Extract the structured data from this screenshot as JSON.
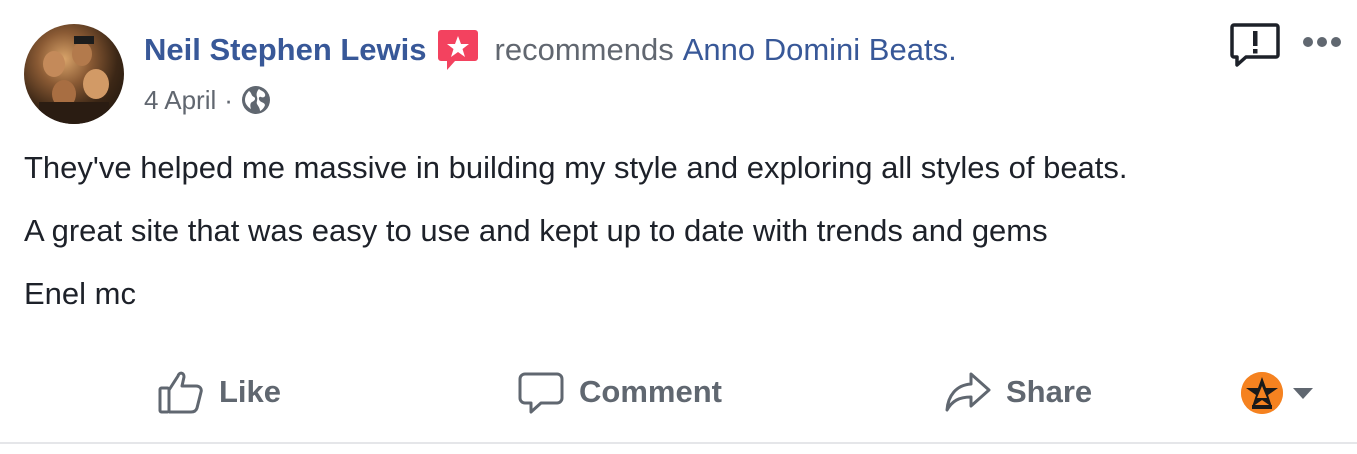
{
  "post": {
    "author": "Neil Stephen Lewis",
    "action_text": "recommends",
    "page_name": "Anno Domini Beats",
    "page_name_suffix": ".",
    "date": "4 April",
    "meta_separator": "·",
    "privacy_icon": "globe-icon",
    "body": [
      "They've helped me massive in building my style and exploring all styles of beats.",
      "A great site that was easy to use and kept up to date with trends and gems",
      "Enel mc"
    ]
  },
  "header_icons": {
    "recommendation_badge": "recommendation-star-icon",
    "report": "report-icon",
    "more": "more-options-icon"
  },
  "actions": {
    "like_label": "Like",
    "comment_label": "Comment",
    "share_label": "Share"
  },
  "colors": {
    "link": "#385898",
    "secondary_text": "#616770",
    "body_text": "#1d2129",
    "action_text": "#606770",
    "recommend_badge": "#f3425f",
    "page_logo": "#f58220",
    "divider": "#e5e6e9"
  }
}
